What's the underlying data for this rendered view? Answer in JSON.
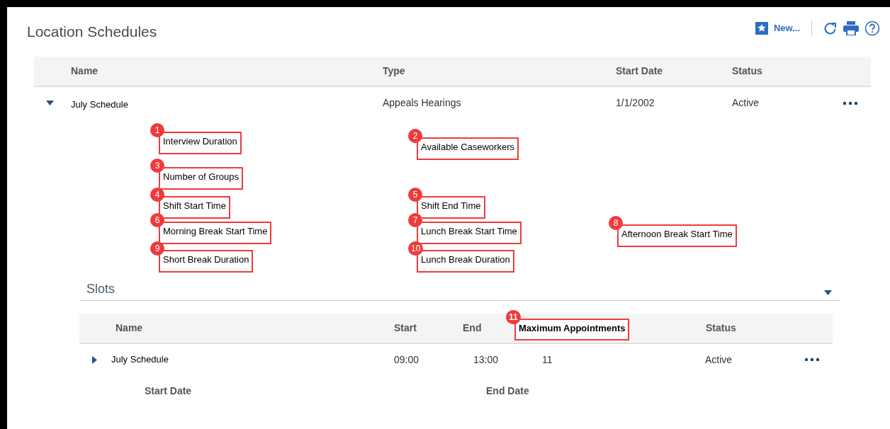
{
  "header": {
    "title": "Location Schedules",
    "new_label": "New..."
  },
  "table": {
    "columns": [
      "Name",
      "Type",
      "Start Date",
      "Status"
    ],
    "rows": [
      {
        "name": "July Schedule",
        "type": "Appeals Hearings",
        "start_date": "1/1/2002",
        "status": "Active",
        "expanded": true
      }
    ]
  },
  "detail_rows": [
    {
      "column_1": {
        "badge": "1",
        "label": "Interview Duration"
      },
      "column_2": {
        "badge": "2",
        "label": "Available Caseworkers"
      }
    },
    {
      "column_1": {
        "badge": "3",
        "label": "Number of Groups"
      }
    },
    {
      "column_1": {
        "badge": "4",
        "label": "Shift Start Time"
      },
      "column_2": {
        "badge": "5",
        "label": "Shift End Time"
      }
    },
    {
      "column_1": {
        "badge": "6",
        "label": "Morning Break Start Time"
      },
      "column_2": {
        "badge": "7",
        "label": "Lunch Break Start Time"
      },
      "column_3": {
        "badge": "8",
        "label": "Afternoon Break Start Time"
      }
    },
    {
      "column_1": {
        "badge": "9",
        "label": "Short Break Duration"
      },
      "column_2": {
        "badge": "10",
        "label": "Lunch Break Duration"
      }
    }
  ],
  "slots": {
    "title": "Slots",
    "expanded": true,
    "columns": [
      {
        "label": "Name"
      },
      {
        "label": "Start"
      },
      {
        "label": "End"
      },
      {
        "label": "Maximum Appointments",
        "badge": "11"
      },
      {
        "label": "Status"
      }
    ],
    "rows": [
      {
        "name": "July Schedule",
        "start": "09:00",
        "end": "13:00",
        "maximum": "11",
        "status": "Active",
        "expanded": false
      }
    ],
    "detail_labels": [
      "Start Date",
      "End Date"
    ]
  }
}
